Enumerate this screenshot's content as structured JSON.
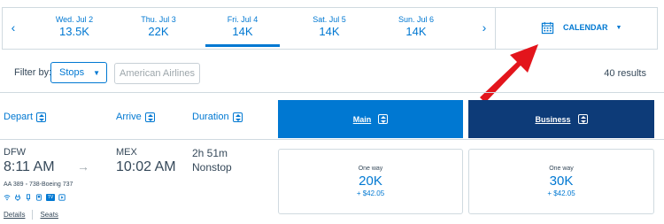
{
  "date_strip": {
    "prev_arrow": "‹",
    "next_arrow": "›",
    "dates": [
      {
        "label": "Wed. Jul 2",
        "price": "13.5K"
      },
      {
        "label": "Thu. Jul 3",
        "price": "22K"
      },
      {
        "label": "Fri. Jul 4",
        "price": "14K",
        "selected": true
      },
      {
        "label": "Sat. Jul 5",
        "price": "14K"
      },
      {
        "label": "Sun. Jul 6",
        "price": "14K"
      }
    ],
    "calendar_label": "CALENDAR",
    "calendar_caret": "▼"
  },
  "filters": {
    "label": "Filter by:",
    "stops_label": "Stops",
    "stops_caret": "▼",
    "airline_label": "American Airlines",
    "results": "40 results"
  },
  "columns": {
    "depart": "Depart",
    "arrive": "Arrive",
    "duration": "Duration",
    "main": "Main",
    "business": "Business"
  },
  "flight": {
    "depart_airport": "DFW",
    "depart_time": "8:11 AM",
    "arrow": "→",
    "arrive_airport": "MEX",
    "arrive_time": "10:02 AM",
    "duration": "2h 51m",
    "stops": "Nonstop",
    "meta": "AA 389 ◦ 738-Boeing 737",
    "amenities": [
      "wifi-icon",
      "power-icon",
      "usb-icon",
      "seatback-icon",
      "tv-icon",
      "app-icon"
    ],
    "details_link": "Details",
    "seats_link": "Seats",
    "main_fare": {
      "one_way": "One way",
      "miles": "20K",
      "tax": "+ $42.05"
    },
    "business_fare": {
      "one_way": "One way",
      "miles": "30K",
      "tax": "+ $42.05"
    }
  },
  "colors": {
    "accent": "#0078d2",
    "business_header": "#0d3b78",
    "annotation_arrow": "#e3151c",
    "text": "#36495a",
    "border": "#d0dae0"
  }
}
